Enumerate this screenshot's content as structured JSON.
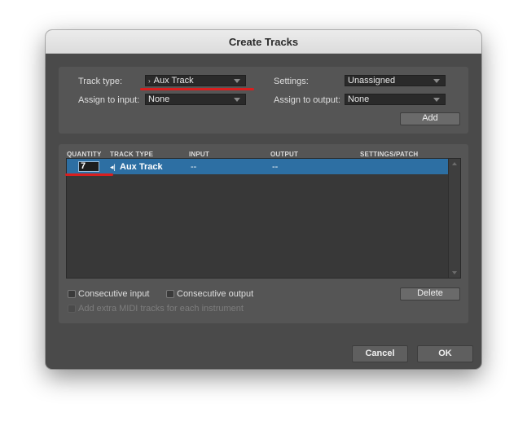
{
  "dialog": {
    "title": "Create Tracks"
  },
  "top_panel": {
    "track_type_label": "Track type:",
    "track_type_value": "Aux Track",
    "assign_input_label": "Assign to input:",
    "assign_input_value": "None",
    "settings_label": "Settings:",
    "settings_value": "Unassigned",
    "assign_output_label": "Assign to output:",
    "assign_output_value": "None",
    "add_button": "Add"
  },
  "table": {
    "columns": [
      "QUANTITY",
      "TRACK TYPE",
      "INPUT",
      "OUTPUT",
      "SETTINGS/PATCH"
    ],
    "rows": [
      {
        "quantity": "7",
        "track_type": "Aux Track",
        "input": "--",
        "output": "--",
        "settings": ""
      }
    ]
  },
  "options": {
    "consecutive_input": "Consecutive input",
    "consecutive_output": "Consecutive output",
    "extra_midi": "Add extra MIDI tracks for each instrument",
    "delete_button": "Delete"
  },
  "footer": {
    "cancel": "Cancel",
    "ok": "OK"
  },
  "colors": {
    "highlight_red": "#d81f1f",
    "row_selected": "#2d6fa3"
  }
}
